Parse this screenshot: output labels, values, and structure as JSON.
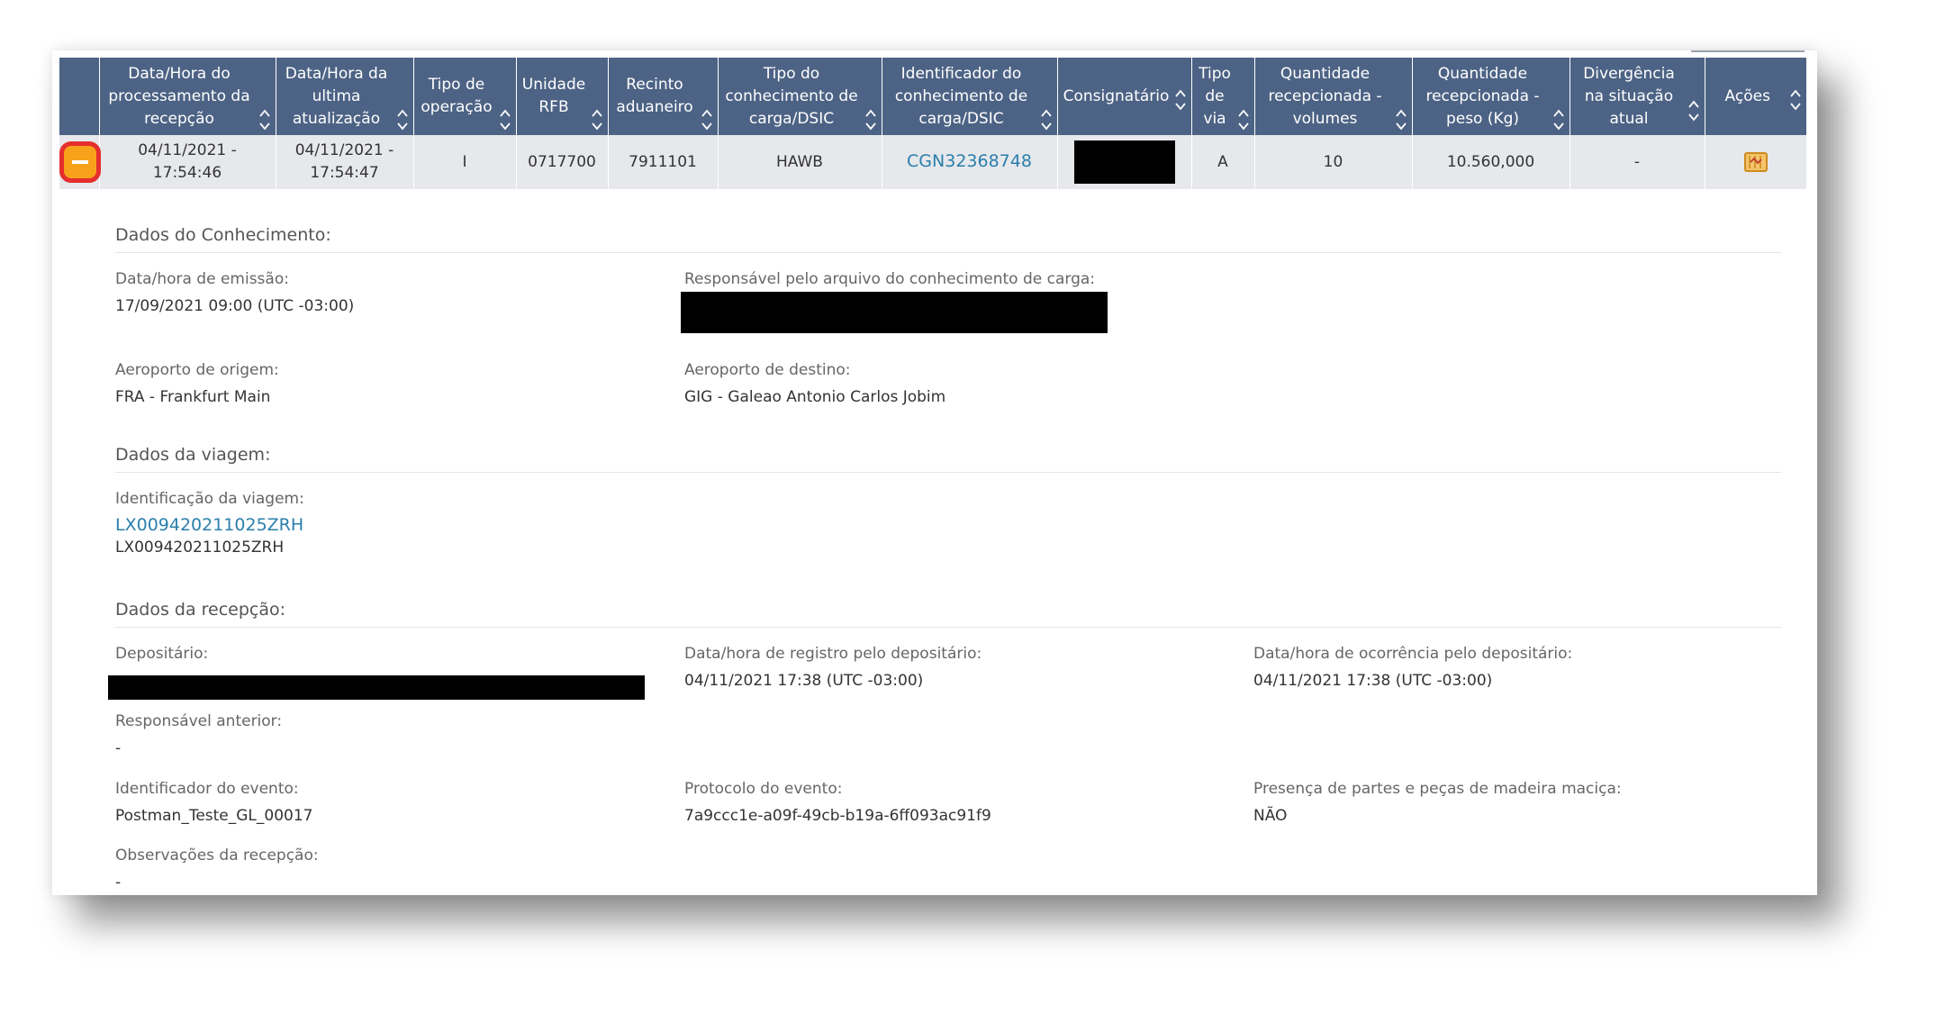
{
  "table": {
    "headers": [
      "Data/Hora do processamento da recepção",
      "Data/Hora da ultima atualização",
      "Tipo de operação",
      "Unidade RFB",
      "Recinto aduaneiro",
      "Tipo do conhecimento de carga/DSIC",
      "Identificador do conhecimento de carga/DSIC",
      "Consignatário",
      "Tipo de via",
      "Quantidade recepcionada - volumes",
      "Quantidade recepcionada - peso (Kg)",
      "Divergência na situação atual",
      "Ações"
    ],
    "row": {
      "processamento": "04/11/2021 - 17:54:46",
      "atualizacao": "04/11/2021 - 17:54:47",
      "tipo_operacao": "I",
      "unidade_rfb": "0717700",
      "recinto": "7911101",
      "tipo_conhecimento": "HAWB",
      "identificador": "CGN32368748",
      "tipo_via": "A",
      "volumes": "10",
      "peso": "10.560,000",
      "divergencia": "-"
    }
  },
  "conhecimento": {
    "title": "Dados do Conhecimento:",
    "emissao_label": "Data/hora de emissão:",
    "emissao_value": "17/09/2021 09:00 (UTC -03:00)",
    "responsavel_label": "Responsável pelo arquivo do conhecimento de carga:",
    "origem_label": "Aeroporto de origem:",
    "origem_value": "FRA - Frankfurt Main",
    "destino_label": "Aeroporto de destino:",
    "destino_value": "GIG - Galeao Antonio Carlos Jobim"
  },
  "viagem": {
    "title": "Dados da viagem:",
    "id_label": "Identificação da viagem:",
    "id_link": "LX009420211025ZRH",
    "id_value": "LX009420211025ZRH"
  },
  "recepcao": {
    "title": "Dados da recepção:",
    "depositario_label": "Depositário:",
    "registro_label": "Data/hora de registro pelo depositário:",
    "registro_value": "04/11/2021 17:38 (UTC -03:00)",
    "ocorrencia_label": "Data/hora de ocorrência pelo depositário:",
    "ocorrencia_value": "04/11/2021 17:38 (UTC -03:00)",
    "resp_anterior_label": "Responsável anterior:",
    "resp_anterior_value": "-",
    "evento_id_label": "Identificador do evento:",
    "evento_id_value": "Postman_Teste_GL_00017",
    "protocolo_label": "Protocolo do evento:",
    "protocolo_value": "7a9ccc1e-a09f-49cb-b19a-6ff093ac91f9",
    "madeira_label": "Presença de partes e peças de madeira maciça:",
    "madeira_value": "NÃO",
    "observacoes_label": "Observações da recepção:",
    "observacoes_value": "-"
  },
  "colors": {
    "header_bg": "#4d6385",
    "row_bg": "#e6e8eb",
    "link": "#2b7fad",
    "collapse_border": "#e52e2e",
    "collapse_fill": "#f7a21a",
    "action_icon": "#e6a43c"
  },
  "icons": {
    "collapse": "minus-collapse-icon",
    "sort": "sort-arrows-icon",
    "action": "map-document-icon"
  }
}
